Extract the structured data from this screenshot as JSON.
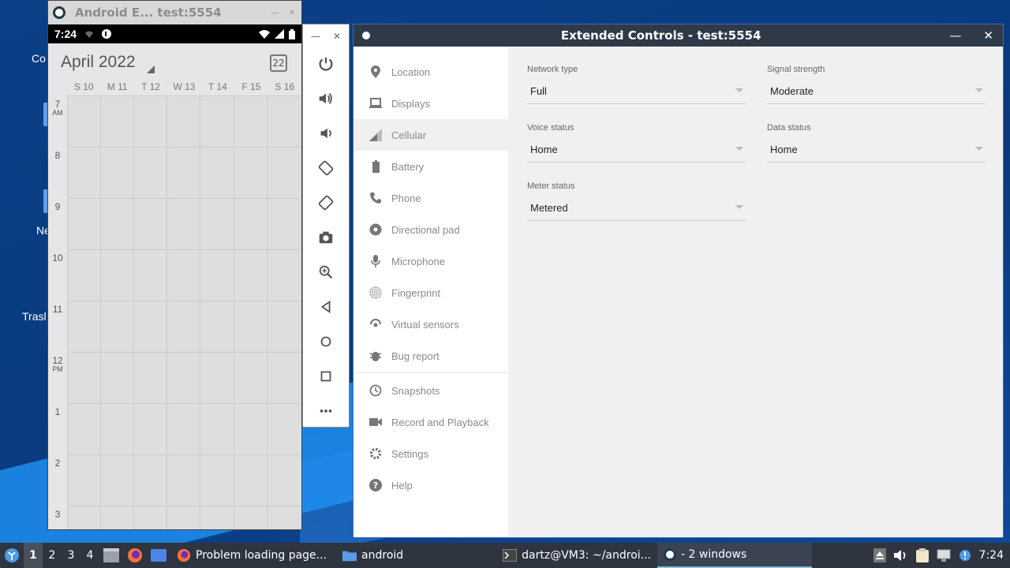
{
  "desktop": {
    "labels": [
      "Co",
      "Ne",
      "Trasl"
    ]
  },
  "emulator": {
    "title": "Android E... test:5554",
    "status_time": "7:24",
    "calendar": {
      "month": "April 2022",
      "today_day": "22",
      "days": [
        "S 10",
        "M 11",
        "T 12",
        "W 13",
        "T 14",
        "F 15",
        "S 16"
      ],
      "hours": [
        {
          "h": "7",
          "ampm": "AM"
        },
        {
          "h": "8",
          "ampm": ""
        },
        {
          "h": "9",
          "ampm": ""
        },
        {
          "h": "10",
          "ampm": ""
        },
        {
          "h": "11",
          "ampm": ""
        },
        {
          "h": "12",
          "ampm": "PM"
        },
        {
          "h": "1",
          "ampm": ""
        },
        {
          "h": "2",
          "ampm": ""
        },
        {
          "h": "3",
          "ampm": ""
        }
      ]
    }
  },
  "side_toolbar": {
    "buttons": [
      "power-icon",
      "volume-up-icon",
      "volume-down-icon",
      "rotate-left-icon",
      "rotate-right-icon",
      "camera-icon",
      "zoom-icon",
      "back-icon",
      "home-icon",
      "overview-icon",
      "more-icon"
    ]
  },
  "extended": {
    "title": "Extended Controls - test:5554",
    "nav": [
      {
        "label": "Location",
        "icon": "location-pin-icon"
      },
      {
        "label": "Displays",
        "icon": "display-icon"
      },
      {
        "label": "Cellular",
        "icon": "signal-icon"
      },
      {
        "label": "Battery",
        "icon": "battery-icon"
      },
      {
        "label": "Phone",
        "icon": "phone-icon"
      },
      {
        "label": "Directional pad",
        "icon": "dpad-icon"
      },
      {
        "label": "Microphone",
        "icon": "microphone-icon"
      },
      {
        "label": "Fingerprint",
        "icon": "fingerprint-icon"
      },
      {
        "label": "Virtual sensors",
        "icon": "sensors-icon"
      },
      {
        "label": "Bug report",
        "icon": "bug-icon"
      },
      {
        "label": "Snapshots",
        "icon": "history-icon"
      },
      {
        "label": "Record and Playback",
        "icon": "video-icon"
      },
      {
        "label": "Settings",
        "icon": "gear-icon"
      },
      {
        "label": "Help",
        "icon": "help-icon"
      }
    ],
    "fields": {
      "network_type": {
        "label": "Network type",
        "value": "Full"
      },
      "signal_strength": {
        "label": "Signal strength",
        "value": "Moderate"
      },
      "voice_status": {
        "label": "Voice status",
        "value": "Home"
      },
      "data_status": {
        "label": "Data status",
        "value": "Home"
      },
      "meter_status": {
        "label": "Meter status",
        "value": "Metered"
      }
    }
  },
  "taskbar": {
    "workspaces": [
      "1",
      "2",
      "3",
      "4"
    ],
    "tasks": [
      {
        "label": "Problem loading page..."
      },
      {
        "label": "android"
      },
      {
        "label": "dartz@VM3: ~/androi..."
      },
      {
        "label": "- 2 windows"
      }
    ],
    "clock": "7:24"
  }
}
